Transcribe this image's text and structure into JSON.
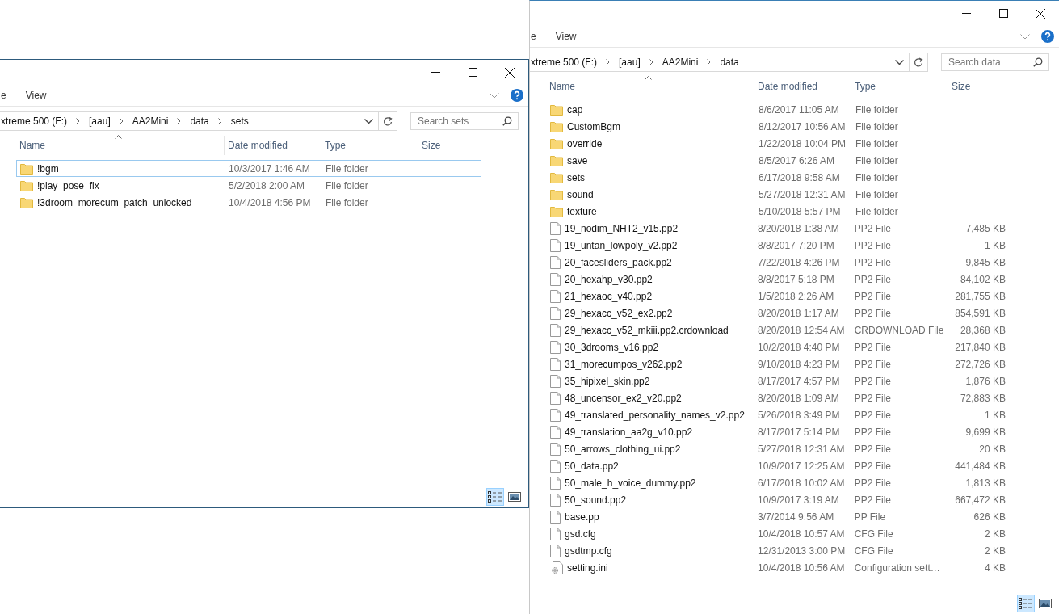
{
  "windows": [
    {
      "ribbon_tabs": [
        "e",
        "View"
      ],
      "breadcrumb": [
        "xtreme 500 (F:)",
        "[aau]",
        "AA2Mini",
        "data",
        "sets"
      ],
      "search": {
        "placeholder": "Search sets"
      },
      "columns": [
        "Name",
        "Date modified",
        "Type",
        "Size"
      ],
      "rows": [
        {
          "kind": "folder",
          "name": "!bgm",
          "date_modified": "10/3/2017 1:46 AM",
          "type": "File folder",
          "focused": true
        },
        {
          "kind": "folder",
          "name": "!play_pose_fix",
          "date_modified": "5/2/2018 2:00 AM",
          "type": "File folder",
          "focused": false
        },
        {
          "kind": "folder",
          "name": "!3droom_morecum_patch_unlocked",
          "date_modified": "10/4/2018 4:56 PM",
          "type": "File folder",
          "focused": false
        }
      ],
      "view_buttons": [
        {
          "kind": "details",
          "selected": true
        },
        {
          "kind": "large-icons",
          "selected": false
        }
      ]
    },
    {
      "ribbon_tabs": [
        "e",
        "View"
      ],
      "breadcrumb": [
        "xtreme 500 (F:)",
        "[aau]",
        "AA2Mini",
        "data"
      ],
      "search": {
        "placeholder": "Search data"
      },
      "columns": [
        "Name",
        "Date modified",
        "Type",
        "Size"
      ],
      "rows": [
        {
          "kind": "folder",
          "name": "cap",
          "date_modified": "8/6/2017 11:05 AM",
          "type": "File folder",
          "focused": false
        },
        {
          "kind": "folder",
          "name": "CustomBgm",
          "date_modified": "8/12/2017 10:56 AM",
          "type": "File folder",
          "focused": false
        },
        {
          "kind": "folder",
          "name": "override",
          "date_modified": "1/22/2018 10:04 PM",
          "type": "File folder",
          "focused": false
        },
        {
          "kind": "folder",
          "name": "save",
          "date_modified": "8/5/2017 6:26 AM",
          "type": "File folder",
          "focused": false
        },
        {
          "kind": "folder",
          "name": "sets",
          "date_modified": "6/17/2018 9:58 AM",
          "type": "File folder",
          "focused": false
        },
        {
          "kind": "folder",
          "name": "sound",
          "date_modified": "5/27/2018 12:31 AM",
          "type": "File folder",
          "focused": false
        },
        {
          "kind": "folder",
          "name": "texture",
          "date_modified": "5/10/2018 5:57 PM",
          "type": "File folder",
          "focused": false
        },
        {
          "kind": "file",
          "name": "19_nodim_NHT2_v15.pp2",
          "date_modified": "8/20/2018 1:38 AM",
          "type": "PP2 File",
          "size": "7,485 KB",
          "focused": false
        },
        {
          "kind": "file",
          "name": "19_untan_lowpoly_v2.pp2",
          "date_modified": "8/8/2017 7:20 PM",
          "type": "PP2 File",
          "size": "1 KB",
          "focused": false
        },
        {
          "kind": "file",
          "name": "20_facesliders_pack.pp2",
          "date_modified": "7/22/2018 4:26 PM",
          "type": "PP2 File",
          "size": "9,845 KB",
          "focused": false
        },
        {
          "kind": "file",
          "name": "20_hexahp_v30.pp2",
          "date_modified": "8/8/2017 5:18 PM",
          "type": "PP2 File",
          "size": "84,102 KB",
          "focused": false
        },
        {
          "kind": "file",
          "name": "21_hexaoc_v40.pp2",
          "date_modified": "1/5/2018 2:26 AM",
          "type": "PP2 File",
          "size": "281,755 KB",
          "focused": false
        },
        {
          "kind": "file",
          "name": "29_hexacc_v52_ex2.pp2",
          "date_modified": "8/20/2018 1:17 AM",
          "type": "PP2 File",
          "size": "854,591 KB",
          "focused": false
        },
        {
          "kind": "file",
          "name": "29_hexacc_v52_mkiii.pp2.crdownload",
          "date_modified": "8/20/2018 12:54 AM",
          "type": "CRDOWNLOAD File",
          "size": "28,368 KB",
          "focused": false
        },
        {
          "kind": "file",
          "name": "30_3drooms_v16.pp2",
          "date_modified": "10/2/2018 4:40 PM",
          "type": "PP2 File",
          "size": "217,840 KB",
          "focused": false
        },
        {
          "kind": "file",
          "name": "31_morecumpos_v262.pp2",
          "date_modified": "9/10/2018 4:23 PM",
          "type": "PP2 File",
          "size": "272,726 KB",
          "focused": false
        },
        {
          "kind": "file",
          "name": "35_hipixel_skin.pp2",
          "date_modified": "8/17/2017 4:57 PM",
          "type": "PP2 File",
          "size": "1,876 KB",
          "focused": false
        },
        {
          "kind": "file",
          "name": "48_uncensor_ex2_v20.pp2",
          "date_modified": "8/20/2018 1:09 AM",
          "type": "PP2 File",
          "size": "72,883 KB",
          "focused": false
        },
        {
          "kind": "file",
          "name": "49_translated_personality_names_v2.pp2",
          "date_modified": "5/26/2018 3:49 PM",
          "type": "PP2 File",
          "size": "1 KB",
          "focused": false
        },
        {
          "kind": "file",
          "name": "49_translation_aa2g_v10.pp2",
          "date_modified": "8/17/2017 5:14 PM",
          "type": "PP2 File",
          "size": "9,699 KB",
          "focused": false
        },
        {
          "kind": "file",
          "name": "50_arrows_clothing_ui.pp2",
          "date_modified": "5/27/2018 12:31 AM",
          "type": "PP2 File",
          "size": "20 KB",
          "focused": false
        },
        {
          "kind": "file",
          "name": "50_data.pp2",
          "date_modified": "10/9/2017 12:25 AM",
          "type": "PP2 File",
          "size": "441,484 KB",
          "focused": false
        },
        {
          "kind": "file",
          "name": "50_male_h_voice_dummy.pp2",
          "date_modified": "6/17/2018 10:02 AM",
          "type": "PP2 File",
          "size": "1,813 KB",
          "focused": false
        },
        {
          "kind": "file",
          "name": "50_sound.pp2",
          "date_modified": "10/9/2017 3:19 AM",
          "type": "PP2 File",
          "size": "667,472 KB",
          "focused": false
        },
        {
          "kind": "file",
          "name": "base.pp",
          "date_modified": "3/7/2014 9:56 AM",
          "type": "PP File",
          "size": "626 KB",
          "focused": false
        },
        {
          "kind": "file",
          "name": "gsd.cfg",
          "date_modified": "10/4/2018 10:57 AM",
          "type": "CFG File",
          "size": "2 KB",
          "focused": false
        },
        {
          "kind": "file",
          "name": "gsdtmp.cfg",
          "date_modified": "12/31/2013 3:00 PM",
          "type": "CFG File",
          "size": "2 KB",
          "focused": false
        },
        {
          "kind": "settings",
          "name": "setting.ini",
          "date_modified": "10/4/2018 10:56 AM",
          "type": "Configuration sett…",
          "size": "4 KB",
          "focused": false
        }
      ],
      "view_buttons": [
        {
          "kind": "details",
          "selected": true
        },
        {
          "kind": "large-icons",
          "selected": false
        }
      ]
    }
  ]
}
